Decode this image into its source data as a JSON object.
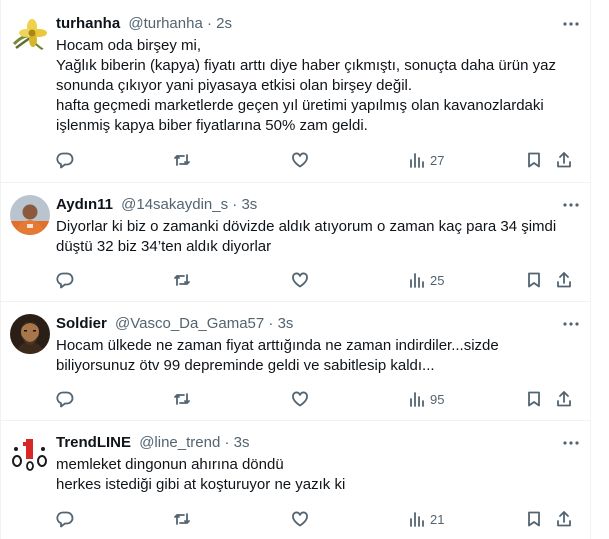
{
  "tweets": [
    {
      "name": "turhanha",
      "handle": "@turhanha",
      "separator": "·",
      "time": "2s",
      "avatar_icon": "flower-icon",
      "lines": [
        "Hocam oda birşey mi,",
        "Yağlık biberin (kapya) fiyatı arttı diye haber çıkmıştı, sonuçta daha ürün yaz",
        "sonunda çıkıyor yani piyasaya etkisi olan birşey değil.",
        "hafta geçmedi marketlerde geçen yıl üretimi yapılmış olan kavanozlardaki",
        "işlenmiş kapya biber fiyatlarına 50% zam geldi."
      ],
      "views": "27"
    },
    {
      "name": "Aydın11",
      "handle": "@14sakaydin_s",
      "separator": "·",
      "time": "3s",
      "avatar_icon": "person-photo-icon",
      "lines": [
        "Diyorlar ki biz o zamanki dövizde aldık atıyorum o zaman kaç para 34 şimdi",
        "düştü 32 biz 34’ten aldık diyorlar"
      ],
      "views": "25"
    },
    {
      "name": "Soldier",
      "handle": "@Vasco_Da_Gama57",
      "separator": "·",
      "time": "3s",
      "avatar_icon": "portrait-icon",
      "lines": [
        "Hocam ülkede ne zaman fiyat arttığında ne zaman indirdiler...sizde",
        "biliyorsunuz ötv 99 depreminde geldi ve sabitlesip kaldı..."
      ],
      "views": "95"
    },
    {
      "name": "TrendLINE",
      "handle": "@line_trend",
      "separator": "·",
      "time": "3s",
      "avatar_icon": "trendline-logo-icon",
      "lines": [
        "memleket dingonun ahırına döndü",
        "herkes istediği gibi at koşturuyor ne yazık ki"
      ],
      "views": "21"
    }
  ]
}
